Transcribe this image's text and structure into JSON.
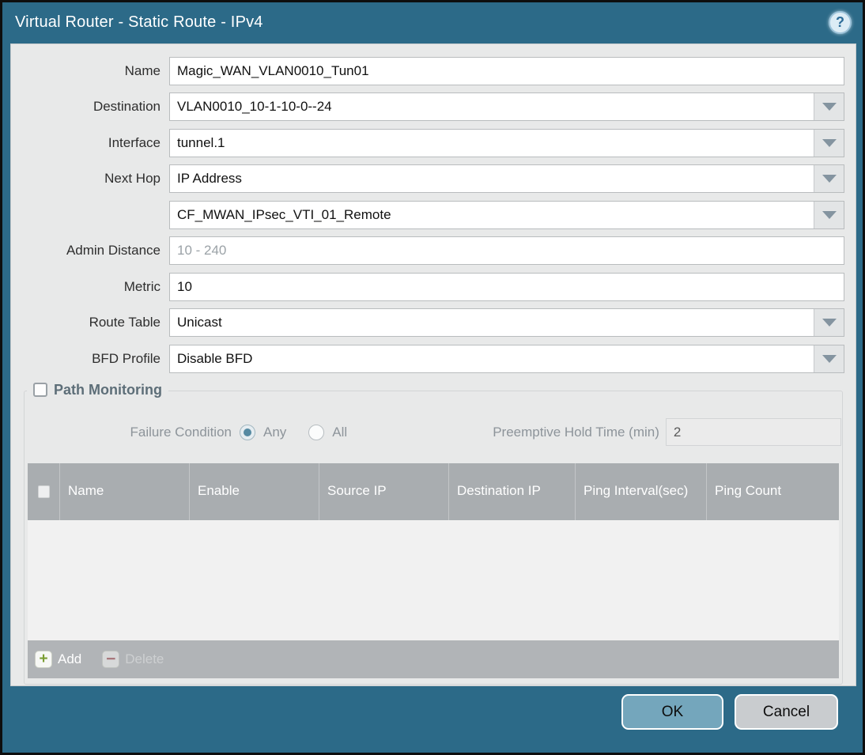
{
  "window": {
    "title": "Virtual Router - Static Route - IPv4",
    "help_glyph": "?"
  },
  "form": {
    "name": {
      "label": "Name",
      "value": "Magic_WAN_VLAN0010_Tun01"
    },
    "destination": {
      "label": "Destination",
      "value": "VLAN0010_10-1-10-0--24"
    },
    "interface": {
      "label": "Interface",
      "value": "tunnel.1"
    },
    "next_hop": {
      "label": "Next Hop",
      "value": "IP Address"
    },
    "next_hop_address": {
      "value": "CF_MWAN_IPsec_VTI_01_Remote"
    },
    "admin_distance": {
      "label": "Admin Distance",
      "value": "",
      "placeholder": "10 - 240"
    },
    "metric": {
      "label": "Metric",
      "value": "10"
    },
    "route_table": {
      "label": "Route Table",
      "value": "Unicast"
    },
    "bfd_profile": {
      "label": "BFD Profile",
      "value": "Disable BFD"
    }
  },
  "path_monitoring": {
    "title": "Path Monitoring",
    "enabled": false,
    "failure_condition": {
      "label": "Failure Condition",
      "options": [
        "Any",
        "All"
      ],
      "selected": "Any"
    },
    "preemptive_hold_time": {
      "label": "Preemptive Hold Time (min)",
      "value": "2"
    },
    "table": {
      "columns": [
        "Name",
        "Enable",
        "Source IP",
        "Destination IP",
        "Ping Interval(sec)",
        "Ping Count"
      ],
      "rows": []
    },
    "toolbar": {
      "add_label": "Add",
      "delete_label": "Delete",
      "add_glyph": "+",
      "delete_glyph": "−"
    }
  },
  "footer": {
    "ok_label": "OK",
    "cancel_label": "Cancel"
  },
  "colors": {
    "accent_teal": "#2c6a88",
    "ok_button": "#74a6bc",
    "cancel_button": "#c9cccf",
    "table_header_gray": "#a9adb0",
    "toolbar_gray": "#b1b4b7",
    "add_plus_green": "#7b9e33",
    "delete_minus_red": "#a2484c",
    "radio_selected_dot": "#568aa2"
  }
}
